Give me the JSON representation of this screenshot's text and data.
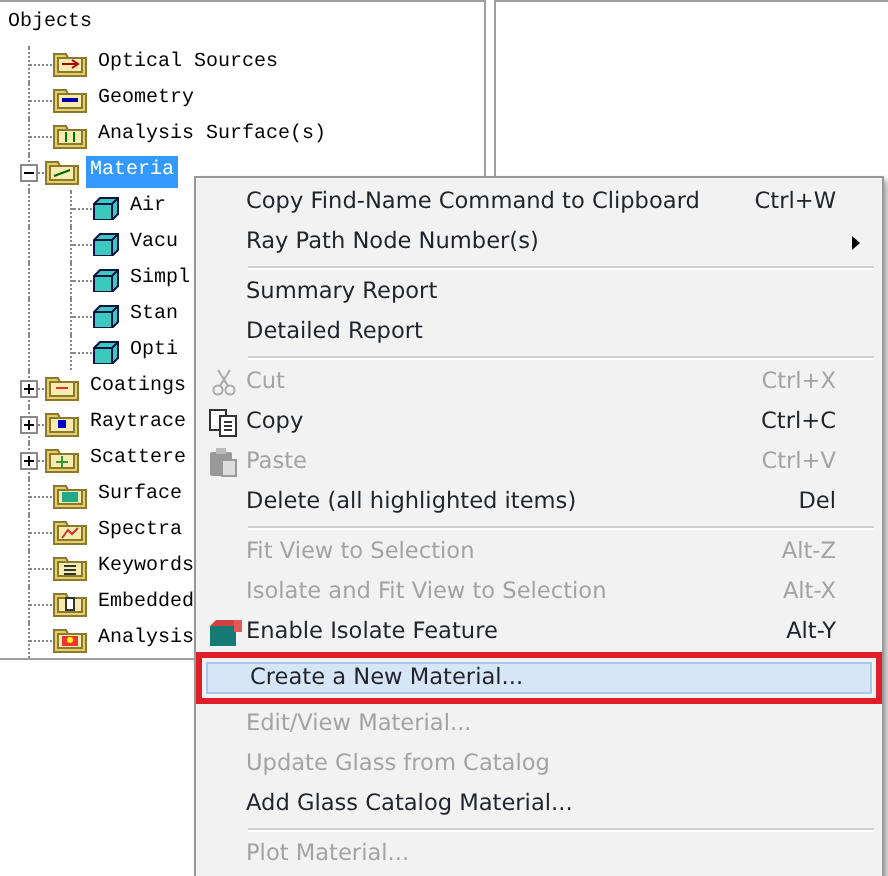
{
  "tree": {
    "header": "Objects",
    "items": [
      {
        "label": "Optical Sources",
        "kind": "leaf",
        "selected": false
      },
      {
        "label": "Geometry",
        "kind": "leaf",
        "selected": false
      },
      {
        "label": "Analysis Surface(s)",
        "kind": "leaf",
        "selected": false
      },
      {
        "label": "Materia",
        "kind": "branch",
        "expanded": true,
        "selected": true,
        "children": [
          {
            "label": "Air",
            "selected": false
          },
          {
            "label": "Vacu",
            "selected": false
          },
          {
            "label": "Simpl",
            "selected": false
          },
          {
            "label": "Stan",
            "selected": false
          },
          {
            "label": "Opti",
            "selected": false
          }
        ]
      },
      {
        "label": "Coatings",
        "kind": "branch",
        "expanded": false,
        "selected": false
      },
      {
        "label": "Raytrace",
        "kind": "branch",
        "expanded": false,
        "selected": false
      },
      {
        "label": "Scattere",
        "kind": "branch",
        "expanded": false,
        "selected": false
      },
      {
        "label": "Surface",
        "kind": "leaf",
        "selected": false
      },
      {
        "label": "Spectra",
        "kind": "leaf",
        "selected": false
      },
      {
        "label": "Keywords",
        "kind": "leaf",
        "selected": false
      },
      {
        "label": "Embedded",
        "kind": "leaf",
        "selected": false
      },
      {
        "label": "Analysis",
        "kind": "leaf",
        "selected": false
      }
    ]
  },
  "context_menu": [
    {
      "kind": "item",
      "label": "Copy Find-Name Command to Clipboard",
      "shortcut": "Ctrl+W",
      "disabled": false,
      "selected": false,
      "outlined": false
    },
    {
      "kind": "item",
      "label": "Ray Path Node Number(s)",
      "submenu": true,
      "disabled": false,
      "selected": false,
      "outlined": false
    },
    {
      "kind": "separator"
    },
    {
      "kind": "item",
      "label": "Summary Report",
      "disabled": false,
      "selected": false,
      "outlined": false
    },
    {
      "kind": "item",
      "label": "Detailed Report",
      "disabled": false,
      "selected": false,
      "outlined": false
    },
    {
      "kind": "separator"
    },
    {
      "kind": "item",
      "label": "Cut",
      "shortcut": "Ctrl+X",
      "disabled": true,
      "selected": false,
      "outlined": false
    },
    {
      "kind": "item",
      "label": "Copy",
      "shortcut": "Ctrl+C",
      "disabled": false,
      "selected": false,
      "outlined": false
    },
    {
      "kind": "item",
      "label": "Paste",
      "shortcut": "Ctrl+V",
      "disabled": true,
      "selected": false,
      "outlined": false
    },
    {
      "kind": "item",
      "label": "Delete (all highlighted items)",
      "shortcut": "Del",
      "disabled": false,
      "selected": false,
      "outlined": false
    },
    {
      "kind": "separator"
    },
    {
      "kind": "item",
      "label": "Fit View to Selection",
      "shortcut": "Alt-Z",
      "disabled": true,
      "selected": false,
      "outlined": false
    },
    {
      "kind": "item",
      "label": "Isolate and Fit View to Selection",
      "shortcut": "Alt-X",
      "disabled": true,
      "selected": false,
      "outlined": false
    },
    {
      "kind": "item",
      "label": "Enable Isolate Feature",
      "shortcut": "Alt-Y",
      "disabled": false,
      "selected": false,
      "outlined": false
    },
    {
      "kind": "item",
      "label": "Create a New Material...",
      "disabled": false,
      "selected": true,
      "outlined": true
    },
    {
      "kind": "item",
      "label": "Edit/View Material...",
      "disabled": true,
      "selected": false,
      "outlined": false
    },
    {
      "kind": "item",
      "label": "Update Glass from Catalog",
      "disabled": true,
      "selected": false,
      "outlined": false
    },
    {
      "kind": "item",
      "label": "Add Glass Catalog Material...",
      "disabled": false,
      "selected": false,
      "outlined": false
    },
    {
      "kind": "separator"
    },
    {
      "kind": "item",
      "label": "Plot Material...",
      "disabled": true,
      "selected": false,
      "outlined": false
    }
  ]
}
